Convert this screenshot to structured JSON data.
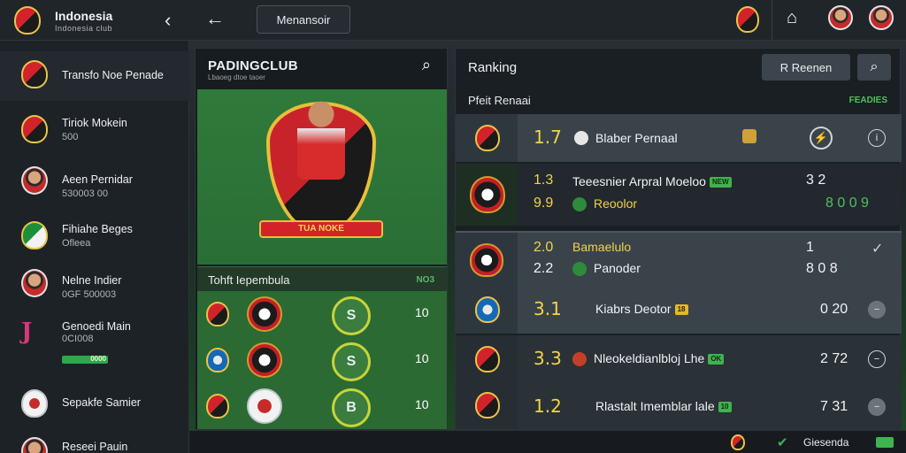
{
  "header": {
    "brand_title": "Indonesia",
    "brand_subtitle": "Indonesia club",
    "tab_label": "Menansoir"
  },
  "sidebar": {
    "items": [
      {
        "label": "Transfo Noe Penade",
        "sub": ""
      },
      {
        "label": "Tiriok Mokein",
        "sub": "500"
      },
      {
        "label": "Aeen Pernidar",
        "sub": "530003 00"
      },
      {
        "label": "Fihiahe Beges",
        "sub": "Ofleea"
      },
      {
        "label": "Nelne Indier",
        "sub": "0GF 500003"
      },
      {
        "label": "Genoedi Main",
        "sub": "0CI008",
        "progress_label": "0000"
      },
      {
        "label": "Sepakfe Samier",
        "sub": ""
      },
      {
        "label": "Reseei Pauin",
        "sub": ""
      }
    ]
  },
  "club": {
    "title": "PADINGCLUB",
    "subtitle": "Lbaoeg dtoe taoer",
    "hero_ribbon": "TUA NOKE",
    "table_title": "Tohft Iepembula",
    "table_badge": "NO3",
    "rows": [
      {
        "ring": "S",
        "value": "10"
      },
      {
        "ring": "S",
        "value": "10"
      },
      {
        "ring": "B",
        "value": "10"
      }
    ]
  },
  "ranking": {
    "title": "Ranking",
    "button_label": "R Reenen",
    "section_label": "Pfeit Renaai",
    "section_badge": "FEADIES",
    "rows": [
      {
        "rank": "1.7",
        "name": "Blaber Pernaal",
        "action": "⚡"
      },
      {
        "rank": "1.3",
        "rank2": "9.9",
        "name": "Teeesnier Arpral Moeloo",
        "tag": "NEW",
        "name2": "Reoolor",
        "score": "3 2",
        "score2": "8 0 0 9"
      },
      {
        "rank": "2.0",
        "rank2": "2.2",
        "name": "Bamaelulo",
        "name2": "Panoder",
        "score": "1",
        "score2": "8 0 8"
      },
      {
        "rank": "3.1",
        "name": "Kiabrs Deotor",
        "tag": "18",
        "score": "0 20"
      },
      {
        "rank": "3.3",
        "name": "Nleokeldianlbloj Lhe",
        "tag": "OK",
        "score": "2 72"
      },
      {
        "rank": "1.2",
        "name": "Rlastalt Imemblar lale",
        "tag": "10",
        "score": "7 31"
      }
    ]
  },
  "footer": {
    "label": "Giesenda"
  },
  "colors": {
    "accent_yellow": "#f2d24a",
    "accent_green": "#4fc05f",
    "brand_red": "#d2232a"
  }
}
